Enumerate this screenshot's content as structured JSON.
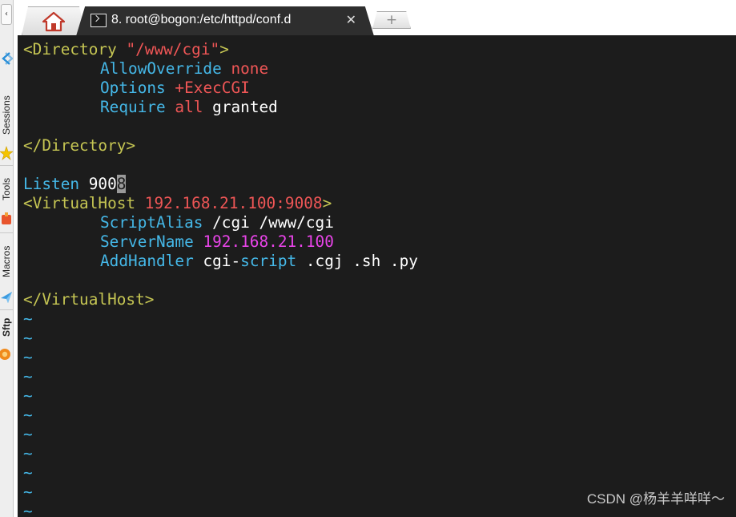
{
  "sidebar": {
    "collapse_glyph": "‹",
    "sections": [
      {
        "label": "Sessions",
        "icon": "sessions-icon"
      },
      {
        "label": "Tools",
        "icon": "tools-icon"
      },
      {
        "label": "Macros",
        "icon": "macros-icon"
      },
      {
        "label": "Sftp",
        "icon": "sftp-icon"
      }
    ]
  },
  "tabs": {
    "home_icon": "home-icon",
    "active": {
      "title": "8. root@bogon:/etc/httpd/conf.d",
      "close_glyph": "✕"
    },
    "new_tab_glyph": "+"
  },
  "terminal": {
    "colors": {
      "background": "#1c1c1c",
      "tag": "#c5c553",
      "keyword": "#45b8e8",
      "value": "#ef5656",
      "host": "#e844e8"
    },
    "dir_open_tag": "<Directory",
    "dir_path": "\"/www/cgi\"",
    "dir_open_close": ">",
    "allow_override_kw": "AllowOverride",
    "allow_override_val": "none",
    "options_kw": "Options",
    "options_val": "+ExecCGI",
    "require_kw": "Require",
    "require_all": "all",
    "require_granted": "granted",
    "dir_close": "</Directory>",
    "listen_kw": "Listen",
    "listen_port_prefix": "900",
    "listen_port_cursor": "8",
    "vhost_open": "<VirtualHost",
    "vhost_addr": "192.168.21.100:9008",
    "vhost_open_close": ">",
    "script_alias_kw": "ScriptAlias",
    "script_alias_val": "/cgi /www/cgi",
    "server_name_kw": "ServerName",
    "server_name_val": "192.168.21.100",
    "add_handler_kw": "AddHandler",
    "add_handler_cgi": "cgi-",
    "add_handler_script": "script",
    "add_handler_ext": " .cgj .sh .py",
    "vhost_close": "</VirtualHost>",
    "empty_marker": "~"
  },
  "watermark": "CSDN @杨羊羊咩咩～"
}
